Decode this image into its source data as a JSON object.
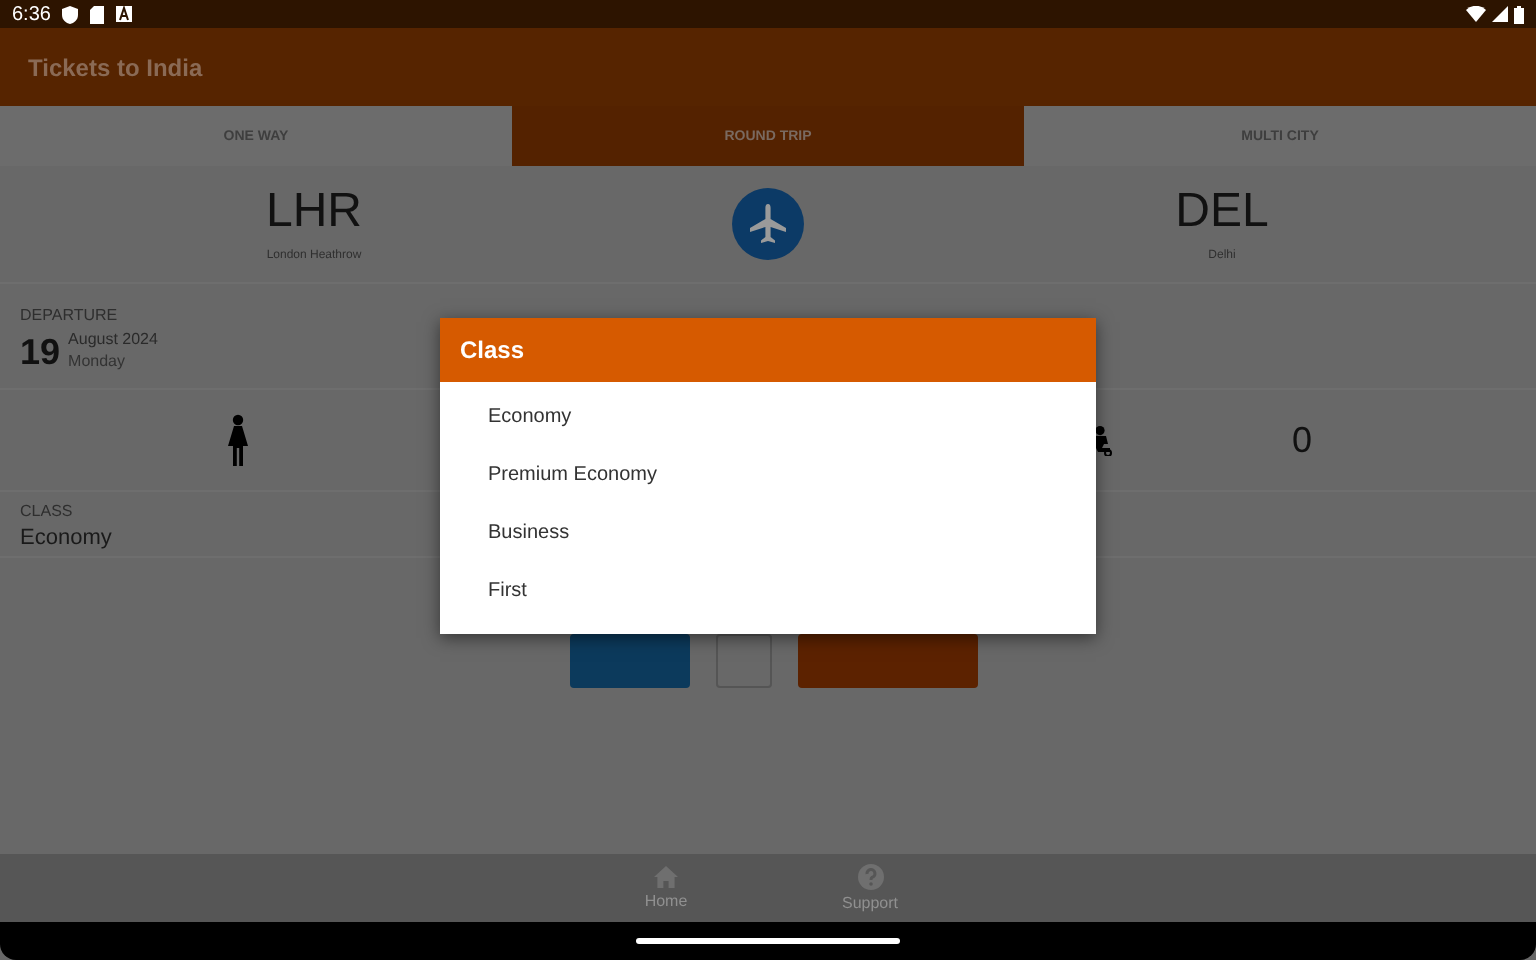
{
  "status_bar": {
    "time": "6:36"
  },
  "app_bar": {
    "title": "Tickets to India"
  },
  "tabs": [
    {
      "label": "ONE WAY",
      "selected": false
    },
    {
      "label": "ROUND TRIP",
      "selected": true
    },
    {
      "label": "MULTI CITY",
      "selected": false
    }
  ],
  "route": {
    "origin": {
      "code": "LHR",
      "name": "London Heathrow"
    },
    "destination": {
      "code": "DEL",
      "name": "Delhi"
    }
  },
  "departure": {
    "label": "DEPARTURE",
    "day": "19",
    "month_year": "August 2024",
    "weekday": "Monday"
  },
  "passengers": {
    "child_count": "0"
  },
  "class_field": {
    "label": "CLASS",
    "value": "Economy"
  },
  "dialog": {
    "title": "Class",
    "options": [
      "Economy",
      "Premium Economy",
      "Business",
      "First"
    ]
  },
  "bottom_nav": [
    {
      "label": "Home",
      "kind": "home"
    },
    {
      "label": "Support",
      "kind": "help"
    }
  ]
}
